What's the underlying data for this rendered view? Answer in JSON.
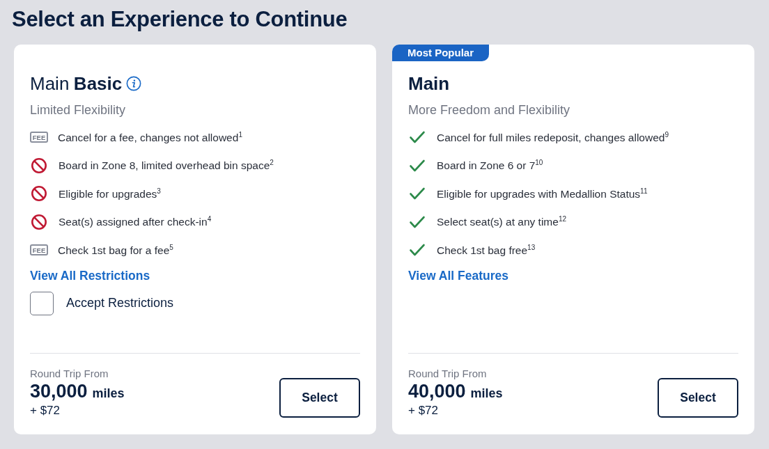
{
  "heading": "Select an Experience to Continue",
  "cards": [
    {
      "title_plain": "Main",
      "title_bold": "Basic",
      "info_icon": true,
      "subtitle": "Limited Flexibility",
      "features": [
        {
          "kind": "fee",
          "badge": "FEE",
          "text": "Cancel for a fee, changes not allowed$^{1}$"
        },
        {
          "kind": "not_allowed",
          "text": "Board in Zone 8, limited overhead bin space$^{2}$"
        },
        {
          "kind": "not_allowed",
          "text": "Eligible for upgrades$^{3}$"
        },
        {
          "kind": "not_allowed",
          "text": "Seat(s) assigned after check-in$^{4}$"
        },
        {
          "kind": "fee",
          "badge": "FEE",
          "text": "Check 1st bag for a fee$^{5}$"
        }
      ],
      "link": "View All Restrictions",
      "accept": {
        "label": "Accept Restrictions",
        "checked": false
      },
      "price": {
        "label": "Round Trip From",
        "amount": "30,000",
        "unit": "miles",
        "fee": "+ $72"
      },
      "button": "Select"
    },
    {
      "badge": "Most Popular",
      "title_bold": "Main",
      "info_icon": false,
      "subtitle": "More Freedom and Flexibility",
      "features": [
        {
          "kind": "included",
          "text": "Cancel for full miles redeposit, changes allowed$^{9}$"
        },
        {
          "kind": "included",
          "text": "Board in Zone 6 or 7$^{10}$"
        },
        {
          "kind": "included",
          "text": "Eligible for upgrades with Medallion Status$^{11}$"
        },
        {
          "kind": "included",
          "text": "Select seat(s) at any time$^{12}$"
        },
        {
          "kind": "included",
          "text": "Check 1st bag free$^{13}$"
        }
      ],
      "link": "View All Features",
      "price": {
        "label": "Round Trip From",
        "amount": "40,000",
        "unit": "miles",
        "fee": "+ $72"
      },
      "button": "Select"
    }
  ]
}
